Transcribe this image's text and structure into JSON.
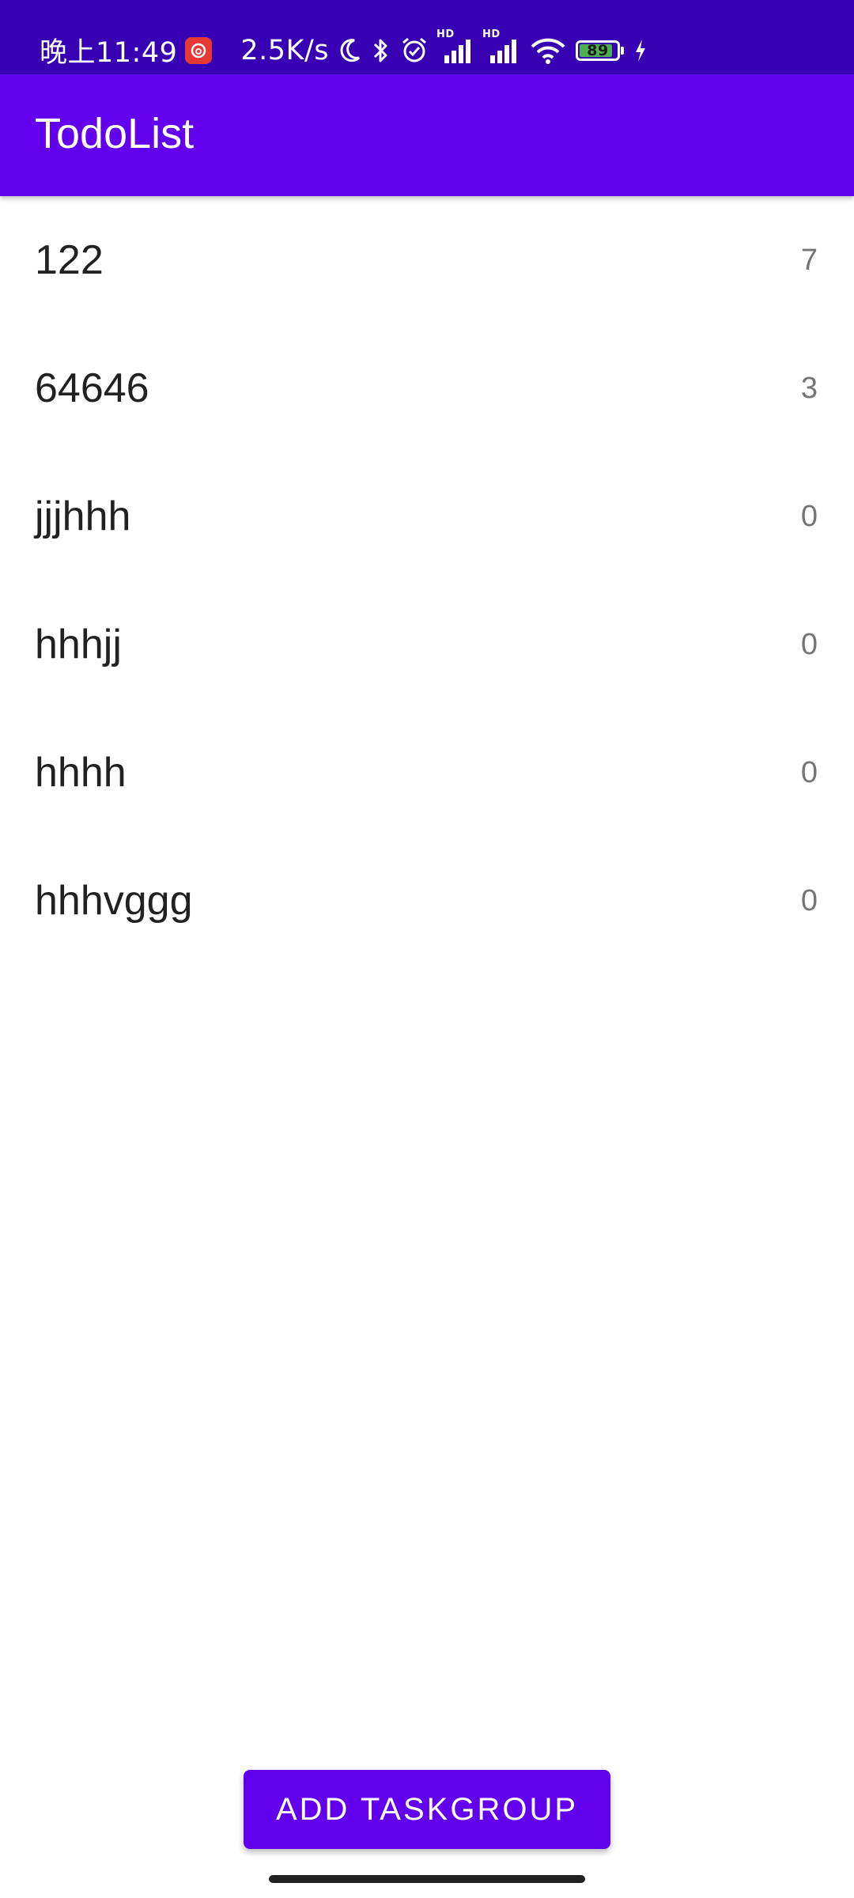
{
  "status_bar": {
    "time": "晚上11:49",
    "net_speed": "2.5K/s",
    "battery_level": "89",
    "battery_percent": 89,
    "icons": [
      "netease-music-icon",
      "moon-icon",
      "bluetooth-icon",
      "alarm-icon",
      "signal-hd-icon",
      "signal-hd-icon",
      "wifi-icon",
      "battery-icon",
      "charging-icon"
    ],
    "colors": {
      "background": "#3700b3",
      "battery_fill": "#4caf50",
      "netease": "#e53935"
    }
  },
  "app_bar": {
    "title": "TodoList",
    "color": "#6200ee"
  },
  "task_groups": [
    {
      "name": "122",
      "count": "7"
    },
    {
      "name": "64646",
      "count": "3"
    },
    {
      "name": "jjjhhh",
      "count": "0"
    },
    {
      "name": "hhhjj",
      "count": "0"
    },
    {
      "name": "hhhh",
      "count": "0"
    },
    {
      "name": "hhhvggg",
      "count": "0"
    }
  ],
  "add_button": {
    "label": "ADD TASKGROUP",
    "color": "#6200ee"
  }
}
